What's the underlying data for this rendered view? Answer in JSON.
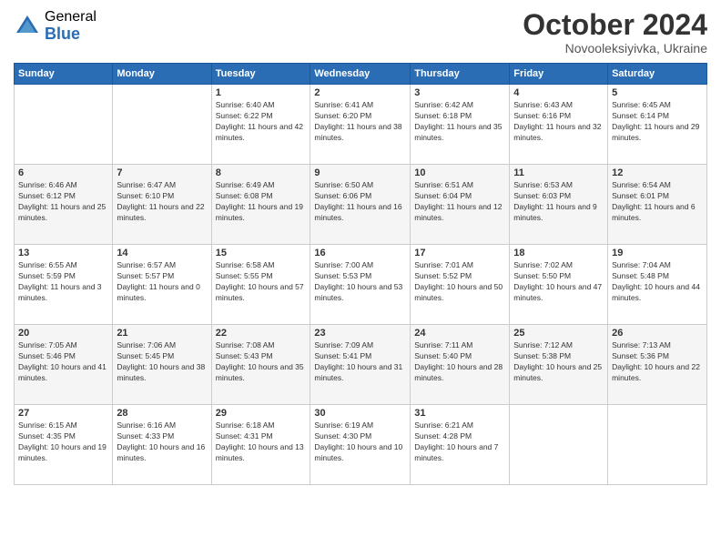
{
  "logo": {
    "general": "General",
    "blue": "Blue"
  },
  "title": "October 2024",
  "subtitle": "Novooleksiyivka, Ukraine",
  "days_of_week": [
    "Sunday",
    "Monday",
    "Tuesday",
    "Wednesday",
    "Thursday",
    "Friday",
    "Saturday"
  ],
  "weeks": [
    [
      {
        "day": "",
        "sunrise": "",
        "sunset": "",
        "daylight": ""
      },
      {
        "day": "",
        "sunrise": "",
        "sunset": "",
        "daylight": ""
      },
      {
        "day": "1",
        "sunrise": "Sunrise: 6:40 AM",
        "sunset": "Sunset: 6:22 PM",
        "daylight": "Daylight: 11 hours and 42 minutes."
      },
      {
        "day": "2",
        "sunrise": "Sunrise: 6:41 AM",
        "sunset": "Sunset: 6:20 PM",
        "daylight": "Daylight: 11 hours and 38 minutes."
      },
      {
        "day": "3",
        "sunrise": "Sunrise: 6:42 AM",
        "sunset": "Sunset: 6:18 PM",
        "daylight": "Daylight: 11 hours and 35 minutes."
      },
      {
        "day": "4",
        "sunrise": "Sunrise: 6:43 AM",
        "sunset": "Sunset: 6:16 PM",
        "daylight": "Daylight: 11 hours and 32 minutes."
      },
      {
        "day": "5",
        "sunrise": "Sunrise: 6:45 AM",
        "sunset": "Sunset: 6:14 PM",
        "daylight": "Daylight: 11 hours and 29 minutes."
      }
    ],
    [
      {
        "day": "6",
        "sunrise": "Sunrise: 6:46 AM",
        "sunset": "Sunset: 6:12 PM",
        "daylight": "Daylight: 11 hours and 25 minutes."
      },
      {
        "day": "7",
        "sunrise": "Sunrise: 6:47 AM",
        "sunset": "Sunset: 6:10 PM",
        "daylight": "Daylight: 11 hours and 22 minutes."
      },
      {
        "day": "8",
        "sunrise": "Sunrise: 6:49 AM",
        "sunset": "Sunset: 6:08 PM",
        "daylight": "Daylight: 11 hours and 19 minutes."
      },
      {
        "day": "9",
        "sunrise": "Sunrise: 6:50 AM",
        "sunset": "Sunset: 6:06 PM",
        "daylight": "Daylight: 11 hours and 16 minutes."
      },
      {
        "day": "10",
        "sunrise": "Sunrise: 6:51 AM",
        "sunset": "Sunset: 6:04 PM",
        "daylight": "Daylight: 11 hours and 12 minutes."
      },
      {
        "day": "11",
        "sunrise": "Sunrise: 6:53 AM",
        "sunset": "Sunset: 6:03 PM",
        "daylight": "Daylight: 11 hours and 9 minutes."
      },
      {
        "day": "12",
        "sunrise": "Sunrise: 6:54 AM",
        "sunset": "Sunset: 6:01 PM",
        "daylight": "Daylight: 11 hours and 6 minutes."
      }
    ],
    [
      {
        "day": "13",
        "sunrise": "Sunrise: 6:55 AM",
        "sunset": "Sunset: 5:59 PM",
        "daylight": "Daylight: 11 hours and 3 minutes."
      },
      {
        "day": "14",
        "sunrise": "Sunrise: 6:57 AM",
        "sunset": "Sunset: 5:57 PM",
        "daylight": "Daylight: 11 hours and 0 minutes."
      },
      {
        "day": "15",
        "sunrise": "Sunrise: 6:58 AM",
        "sunset": "Sunset: 5:55 PM",
        "daylight": "Daylight: 10 hours and 57 minutes."
      },
      {
        "day": "16",
        "sunrise": "Sunrise: 7:00 AM",
        "sunset": "Sunset: 5:53 PM",
        "daylight": "Daylight: 10 hours and 53 minutes."
      },
      {
        "day": "17",
        "sunrise": "Sunrise: 7:01 AM",
        "sunset": "Sunset: 5:52 PM",
        "daylight": "Daylight: 10 hours and 50 minutes."
      },
      {
        "day": "18",
        "sunrise": "Sunrise: 7:02 AM",
        "sunset": "Sunset: 5:50 PM",
        "daylight": "Daylight: 10 hours and 47 minutes."
      },
      {
        "day": "19",
        "sunrise": "Sunrise: 7:04 AM",
        "sunset": "Sunset: 5:48 PM",
        "daylight": "Daylight: 10 hours and 44 minutes."
      }
    ],
    [
      {
        "day": "20",
        "sunrise": "Sunrise: 7:05 AM",
        "sunset": "Sunset: 5:46 PM",
        "daylight": "Daylight: 10 hours and 41 minutes."
      },
      {
        "day": "21",
        "sunrise": "Sunrise: 7:06 AM",
        "sunset": "Sunset: 5:45 PM",
        "daylight": "Daylight: 10 hours and 38 minutes."
      },
      {
        "day": "22",
        "sunrise": "Sunrise: 7:08 AM",
        "sunset": "Sunset: 5:43 PM",
        "daylight": "Daylight: 10 hours and 35 minutes."
      },
      {
        "day": "23",
        "sunrise": "Sunrise: 7:09 AM",
        "sunset": "Sunset: 5:41 PM",
        "daylight": "Daylight: 10 hours and 31 minutes."
      },
      {
        "day": "24",
        "sunrise": "Sunrise: 7:11 AM",
        "sunset": "Sunset: 5:40 PM",
        "daylight": "Daylight: 10 hours and 28 minutes."
      },
      {
        "day": "25",
        "sunrise": "Sunrise: 7:12 AM",
        "sunset": "Sunset: 5:38 PM",
        "daylight": "Daylight: 10 hours and 25 minutes."
      },
      {
        "day": "26",
        "sunrise": "Sunrise: 7:13 AM",
        "sunset": "Sunset: 5:36 PM",
        "daylight": "Daylight: 10 hours and 22 minutes."
      }
    ],
    [
      {
        "day": "27",
        "sunrise": "Sunrise: 6:15 AM",
        "sunset": "Sunset: 4:35 PM",
        "daylight": "Daylight: 10 hours and 19 minutes."
      },
      {
        "day": "28",
        "sunrise": "Sunrise: 6:16 AM",
        "sunset": "Sunset: 4:33 PM",
        "daylight": "Daylight: 10 hours and 16 minutes."
      },
      {
        "day": "29",
        "sunrise": "Sunrise: 6:18 AM",
        "sunset": "Sunset: 4:31 PM",
        "daylight": "Daylight: 10 hours and 13 minutes."
      },
      {
        "day": "30",
        "sunrise": "Sunrise: 6:19 AM",
        "sunset": "Sunset: 4:30 PM",
        "daylight": "Daylight: 10 hours and 10 minutes."
      },
      {
        "day": "31",
        "sunrise": "Sunrise: 6:21 AM",
        "sunset": "Sunset: 4:28 PM",
        "daylight": "Daylight: 10 hours and 7 minutes."
      },
      {
        "day": "",
        "sunrise": "",
        "sunset": "",
        "daylight": ""
      },
      {
        "day": "",
        "sunrise": "",
        "sunset": "",
        "daylight": ""
      }
    ]
  ]
}
